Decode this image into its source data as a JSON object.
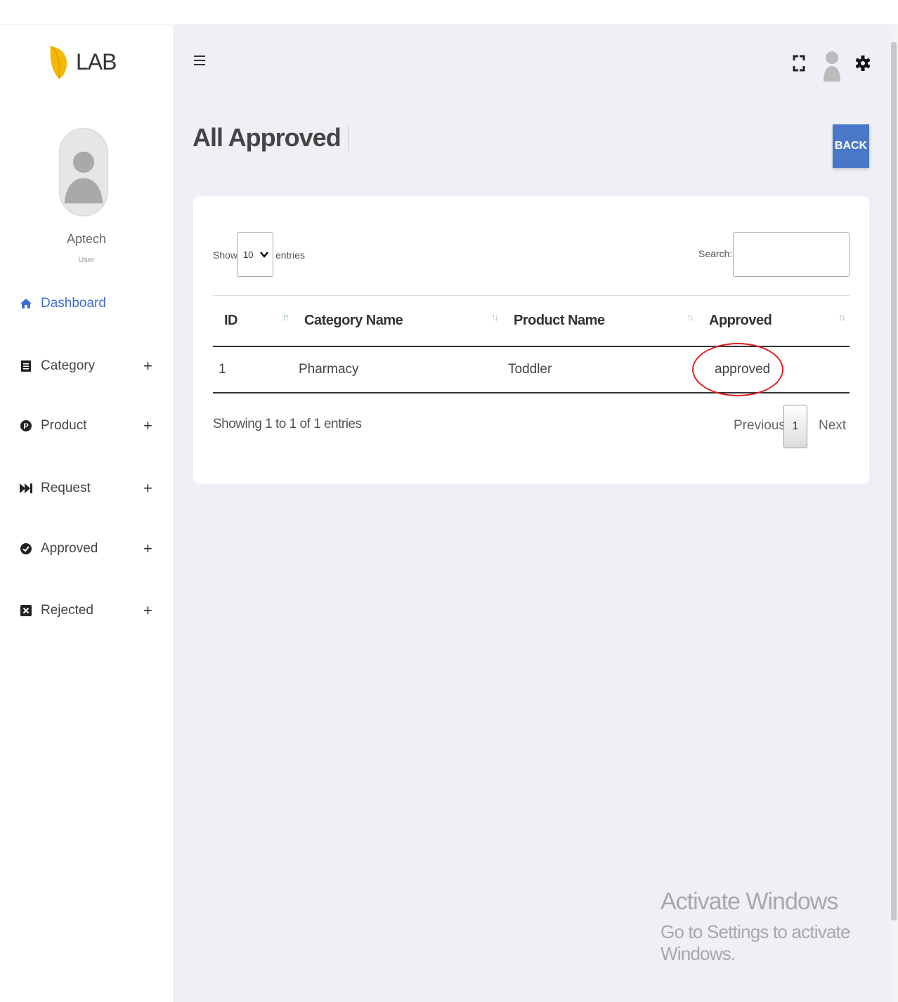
{
  "app": {
    "logo_text": "LAB"
  },
  "user": {
    "name": "Aptech",
    "role": "User"
  },
  "sidebar": {
    "items": [
      {
        "label": "Dashboard",
        "icon": "home-icon",
        "active": true,
        "expand": ""
      },
      {
        "label": "Category",
        "icon": "list-icon",
        "active": false,
        "expand": "+"
      },
      {
        "label": "Product",
        "icon": "p-badge-icon",
        "active": false,
        "expand": "+"
      },
      {
        "label": "Request",
        "icon": "fast-forward-icon",
        "active": false,
        "expand": "+"
      },
      {
        "label": "Approved",
        "icon": "check-circle-icon",
        "active": false,
        "expand": "+"
      },
      {
        "label": "Rejected",
        "icon": "x-square-icon",
        "active": false,
        "expand": "+"
      }
    ]
  },
  "page": {
    "title": "All Approved",
    "back_label": "BACK"
  },
  "table_controls": {
    "show_label": "Show",
    "page_length": "10",
    "entries_label": "entries",
    "search_label": "Search:",
    "search_value": ""
  },
  "table": {
    "columns": [
      "ID",
      "Category Name",
      "Product Name",
      "Approved"
    ],
    "rows": [
      {
        "id": "1",
        "category": "Pharmacy",
        "product": "Toddler",
        "approved": "approved"
      }
    ]
  },
  "pagination": {
    "info": "Showing 1 to 1 of 1 entries",
    "previous": "Previous",
    "current": "1",
    "next": "Next"
  },
  "watermark": {
    "title": "Activate Windows",
    "subtitle": "Go to Settings to activate Windows."
  },
  "colors": {
    "accent": "#4a78c8",
    "active_nav": "#3f6ccf",
    "logo": "#f5b800",
    "annotation": "#e02020"
  }
}
